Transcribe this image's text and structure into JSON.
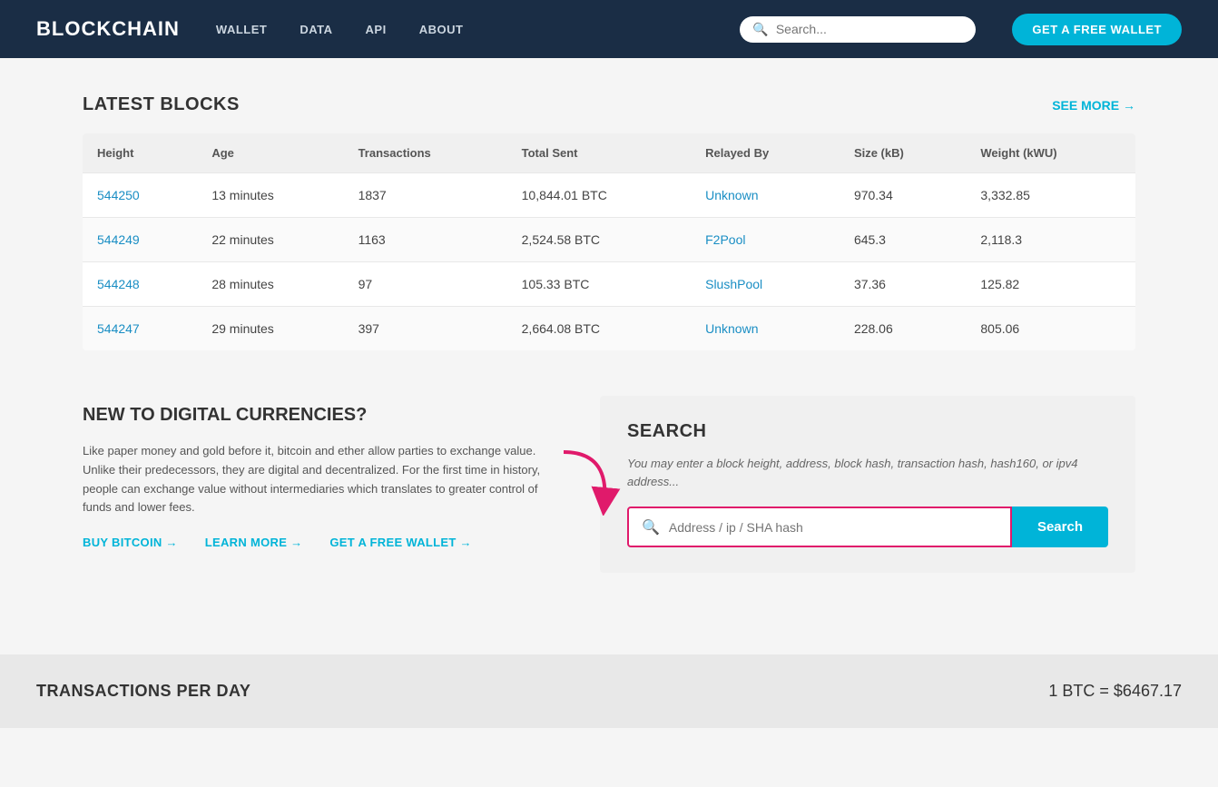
{
  "nav": {
    "brand": "BLOCKCHAIN",
    "links": [
      "WALLET",
      "DATA",
      "API",
      "ABOUT"
    ],
    "search_placeholder": "Search...",
    "cta": "GET A FREE WALLET"
  },
  "latest_blocks": {
    "title": "LATEST BLOCKS",
    "see_more": "SEE MORE →",
    "columns": [
      "Height",
      "Age",
      "Transactions",
      "Total Sent",
      "Relayed By",
      "Size (kB)",
      "Weight (kWU)"
    ],
    "rows": [
      {
        "height": "544250",
        "age": "13 minutes",
        "transactions": "1837",
        "total_sent": "10,844.01 BTC",
        "relayed_by": "Unknown",
        "size": "970.34",
        "weight": "3,332.85"
      },
      {
        "height": "544249",
        "age": "22 minutes",
        "transactions": "1163",
        "total_sent": "2,524.58 BTC",
        "relayed_by": "F2Pool",
        "size": "645.3",
        "weight": "2,118.3"
      },
      {
        "height": "544248",
        "age": "28 minutes",
        "transactions": "97",
        "total_sent": "105.33 BTC",
        "relayed_by": "SlushPool",
        "size": "37.36",
        "weight": "125.82"
      },
      {
        "height": "544247",
        "age": "29 minutes",
        "transactions": "397",
        "total_sent": "2,664.08 BTC",
        "relayed_by": "Unknown",
        "size": "228.06",
        "weight": "805.06"
      }
    ]
  },
  "new_to_digital": {
    "title": "NEW TO DIGITAL CURRENCIES?",
    "description": "Like paper money and gold before it, bitcoin and ether allow parties to exchange value. Unlike their predecessors, they are digital and decentralized. For the first time in history, people can exchange value without intermediaries which translates to greater control of funds and lower fees.",
    "links": [
      "BUY BITCOIN →",
      "LEARN MORE →",
      "GET A FREE WALLET →"
    ]
  },
  "search_section": {
    "title": "SEARCH",
    "hint": "You may enter a block height, address, block hash, transaction hash, hash160, or ipv4 address...",
    "input_placeholder": "Address / ip / SHA hash",
    "button_label": "Search"
  },
  "footer": {
    "left": "TRANSACTIONS PER DAY",
    "right": "1 BTC = $6467.17"
  }
}
